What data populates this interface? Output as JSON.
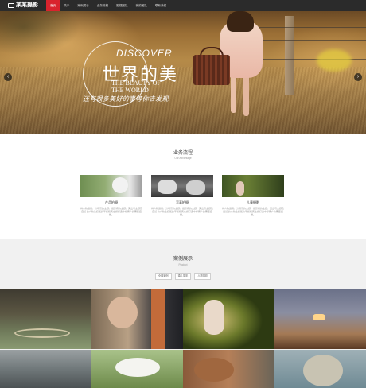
{
  "nav": {
    "logo": "某某摄影",
    "items": [
      "首页",
      "关于",
      "案例展示",
      "业务流程",
      "影视团队",
      "我的团队",
      "联系我们"
    ]
  },
  "hero": {
    "eyebrow": "DISCOVER",
    "title": "世界的美",
    "title_en": "THE BEAUTY OF\nTHE WORLD",
    "subtitle": "还有很多美好的事等你去发现",
    "prev": "‹",
    "next": "›"
  },
  "services": {
    "title": "业务流程",
    "subtitle": "Our Advantage",
    "items": [
      {
        "label": "产品拍摄",
        "desc": "将人物运用，分场景的主题，摄影者的主题，突出与主题及自然\n的人物性质能的平衡和实在感打造中好客户的需要结婚。"
      },
      {
        "label": "写真拍摄",
        "desc": "将人物运用，分场景的主题，摄影者的主题，突出与主题及自然\n的人物性质能的平衡和实在感打造中好客户的需要结婚。"
      },
      {
        "label": "儿童摄影",
        "desc": "将人物运用，分场景的主题，摄影者的主题，突出与主题及自然\n的人物性质能的平衡和实在感打造中好客户的需要结婚。"
      }
    ]
  },
  "cases": {
    "title": "案例展示",
    "subtitle": "Product",
    "filters": [
      "全部案例",
      "婚礼摄影",
      "人物摄影"
    ]
  }
}
